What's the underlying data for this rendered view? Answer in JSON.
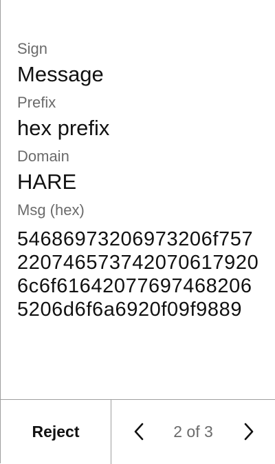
{
  "fields": {
    "sign_label": "Sign",
    "sign_value": "Message",
    "prefix_label": "Prefix",
    "prefix_value": "hex prefix",
    "domain_label": "Domain",
    "domain_value": "HARE",
    "msg_label": "Msg (hex)",
    "msg_value": "54686973206973206f7572207465737420706179206c6f616420776974682065206d6f6a6920f09f9889"
  },
  "footer": {
    "reject_label": "Reject",
    "page_indicator": "2 of 3",
    "prev_icon": "chevron-left-icon",
    "next_icon": "chevron-right-icon"
  }
}
